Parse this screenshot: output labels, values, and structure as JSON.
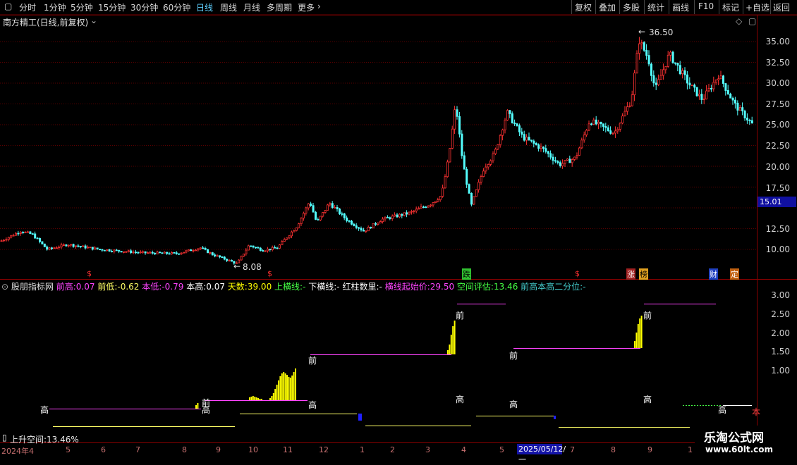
{
  "toolbar": {
    "left_icon": "square-icon",
    "periods": [
      "分时",
      "1分钟",
      "5分钟",
      "15分钟",
      "30分钟",
      "60分钟",
      "日线",
      "周线",
      "月线",
      "多周期",
      "更多"
    ],
    "active_period": "日线",
    "more_arrow": "chevron-right-icon",
    "actions": [
      "复权",
      "叠加",
      "多股",
      "统计",
      "画线",
      "F10",
      "标记",
      "+自选",
      "返回"
    ]
  },
  "main_panel": {
    "title": "南方精工(日线,前复权)",
    "title_icon": "chevron-down-icon",
    "right_icons": [
      "diamond-icon",
      "square-icon"
    ],
    "y_axis_labels": [
      "35.00",
      "32.50",
      "30.00",
      "27.50",
      "25.00",
      "22.50",
      "20.00",
      "17.50",
      "15.01",
      "12.50",
      "10.00"
    ],
    "current_price": "15.01",
    "high_annotation": "36.50",
    "low_annotation": "8.08",
    "markers": [
      "$",
      "$",
      "跌",
      "$",
      "涨",
      "榜",
      "财",
      "定"
    ]
  },
  "indicator_panel": {
    "name": "股朋指标网",
    "fields": [
      {
        "label": "前高:",
        "value": "0.07",
        "color": "#ff44ff"
      },
      {
        "label": "前低:",
        "value": "-0.62",
        "color": "#ffff44"
      },
      {
        "label": "本低:",
        "value": "-0.79",
        "color": "#ff44ff"
      },
      {
        "label": "本高:",
        "value": "0.07",
        "color": "#ffffff"
      },
      {
        "label": "天数:",
        "value": "39.00",
        "color": "#ffff00"
      },
      {
        "label": "上横线:",
        "value": "-",
        "color": "#44ff44"
      },
      {
        "label": "下横线:",
        "value": "-",
        "color": "#ffffff"
      },
      {
        "label": "红柱数里:",
        "value": "-",
        "color": "#ffffff"
      },
      {
        "label": "横线起始价:",
        "value": "29.50",
        "color": "#ff44ff"
      },
      {
        "label": "空间评估:",
        "value": "13.46",
        "color": "#44ff44"
      },
      {
        "label": "前高本高二分位:",
        "value": "-",
        "color": "#44cccc"
      }
    ],
    "y_axis_labels": [
      "3.00",
      "2.50",
      "2.00",
      "1.50",
      "1.00"
    ],
    "chart_labels": [
      "高",
      "前",
      "高",
      "前",
      "高",
      "前",
      "高",
      "前",
      "高",
      "高",
      "本"
    ],
    "bottom_text": "上升空间:13.46%"
  },
  "x_axis": {
    "labels": [
      "2024年4",
      "5",
      "6",
      "7",
      "8",
      "9",
      "10",
      "11",
      "12",
      "1",
      "2",
      "3",
      "4",
      "5",
      "7",
      "8",
      "9",
      "1"
    ],
    "selected_date": "2025/05/12/一"
  },
  "watermark": {
    "line1": "乐淘公式网",
    "line2": "www.60lt.com"
  }
}
